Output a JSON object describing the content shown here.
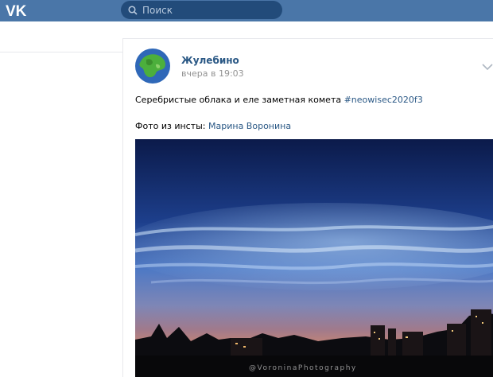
{
  "header": {
    "logo_text": "VK",
    "search": {
      "placeholder": "Поиск",
      "value": ""
    }
  },
  "colors": {
    "brand": "#4a76a8",
    "link": "#2a5885",
    "search_bg": "#224b7a"
  },
  "post": {
    "author": "Жулебино",
    "time": "вчера в 19:03",
    "text_prefix": "Серебристые облака и еле заметная комета ",
    "hashtag": "#neowisec2020f3",
    "credit_prefix": "Фото из инсты: ",
    "credit_name": "Марина Воронина",
    "photo_watermark": "@VoroninaPhotography",
    "menu_icon": "chevron-down-icon"
  }
}
